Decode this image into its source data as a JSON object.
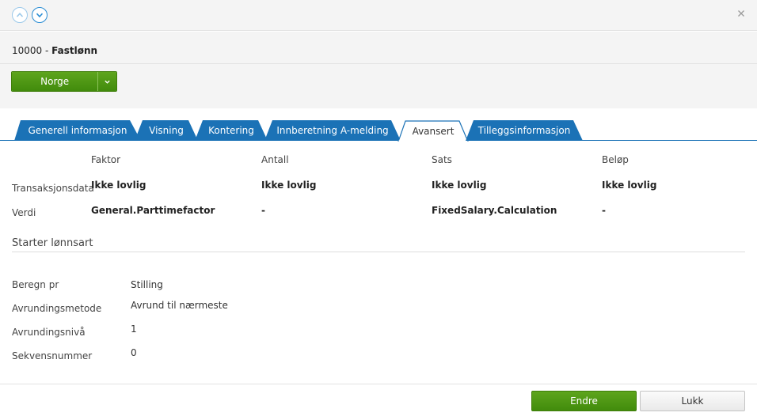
{
  "header": {
    "code": "10000",
    "separator": " - ",
    "name": "Fastlønn"
  },
  "colors": {
    "accent_blue": "#1b72b6",
    "primary_green": "#4a9612"
  },
  "actions": {
    "country_button": "Norge"
  },
  "tabs": [
    {
      "label": "Generell informasjon",
      "active": false
    },
    {
      "label": "Visning",
      "active": false
    },
    {
      "label": "Kontering",
      "active": false
    },
    {
      "label": "Innberetning A-melding",
      "active": false
    },
    {
      "label": "Avansert",
      "active": true
    },
    {
      "label": "Tilleggsinformasjon",
      "active": false
    }
  ],
  "grid": {
    "columns": [
      "Faktor",
      "Antall",
      "Sats",
      "Beløp"
    ],
    "rows": [
      {
        "label": "Transaksjonsdata",
        "values": [
          "Ikke lovlig",
          "Ikke lovlig",
          "Ikke lovlig",
          "Ikke lovlig"
        ]
      },
      {
        "label": "Verdi",
        "values": [
          "General.Parttimefactor",
          "-",
          "FixedSalary.Calculation",
          "-"
        ]
      }
    ]
  },
  "section": {
    "title": "Starter lønnsart"
  },
  "fields": [
    {
      "label": "Beregn pr",
      "value": "Stilling"
    },
    {
      "label": "Avrundingsmetode",
      "value": "Avrund til nærmeste"
    },
    {
      "label": "Avrundingsnivå",
      "value": "1"
    },
    {
      "label": "Sekvensnummer",
      "value": "0"
    }
  ],
  "footer": {
    "edit_button": "Endre",
    "close_button": "Lukk"
  }
}
